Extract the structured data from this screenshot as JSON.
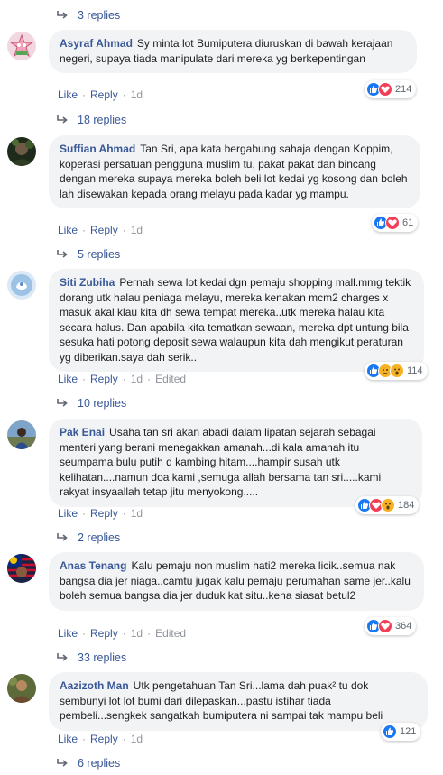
{
  "top_replies": {
    "label": "3 replies"
  },
  "comments": [
    {
      "author": "Asyraf Ahmad",
      "text": "Sy minta lot Bumiputera diuruskan di bawah kerajaan negeri, supaya tiada manipulate dari mereka yg berkepentingan",
      "like": "Like",
      "reply": "Reply",
      "time": "1d",
      "edited": "",
      "reaction_count": "214",
      "reactions": [
        "like-icon",
        "love-icon"
      ],
      "replies_label": "18 replies"
    },
    {
      "author": "Suffian Ahmad",
      "text": "Tan Sri, apa kata bergabung sahaja dengan Koppim, koperasi persatuan pengguna muslim tu, pakat pakat dan bincang dengan mereka supaya mereka boleh beli lot kedai yg kosong dan boleh lah disewakan kepada orang melayu pada kadar yg mampu.",
      "like": "Like",
      "reply": "Reply",
      "time": "1d",
      "edited": "",
      "reaction_count": "61",
      "reactions": [
        "like-icon",
        "love-icon"
      ],
      "replies_label": "5 replies"
    },
    {
      "author": "Siti Zubiha",
      "text": "Pernah sewa lot kedai dgn pemaju shopping mall.mmg tektik dorang utk halau peniaga melayu, mereka kenakan mcm2 charges x masuk akal klau kita dh sewa tempat mereka..utk mereka halau kita secara halus. Dan apabila kita tematkan sewaan, mereka dpt untung bila sesuka hati potong deposit sewa walaupun kita dah mengikut peraturan yg diberikan.saya dah serik..",
      "like": "Like",
      "reply": "Reply",
      "time": "1d",
      "edited": "Edited",
      "reaction_count": "114",
      "reactions": [
        "like-icon",
        "sad-icon",
        "wow-icon"
      ],
      "replies_label": "10 replies"
    },
    {
      "author": "Pak Enai",
      "text": "Usaha tan sri akan abadi dalam lipatan sejarah sebagai menteri yang berani menegakkan amanah...di kala amanah itu seumpama bulu putih d kambing hitam....hampir susah utk kelihatan....namun doa kami ,semuga allah bersama tan sri.....kami rakyat insyaallah tetap jitu menyokong.....",
      "like": "Like",
      "reply": "Reply",
      "time": "1d",
      "edited": "",
      "reaction_count": "184",
      "reactions": [
        "like-icon",
        "love-icon",
        "wow-icon"
      ],
      "replies_label": "2 replies"
    },
    {
      "author": "Anas Tenang",
      "text": "Kalu pemaju non muslim hati2 mereka licik..semua nak bangsa dia jer niaga..camtu jugak kalu pemaju perumahan same jer..kalu boleh semua bangsa dia jer duduk kat situ..kena siasat betul2",
      "like": "Like",
      "reply": "Reply",
      "time": "1d",
      "edited": "Edited",
      "reaction_count": "364",
      "reactions": [
        "like-icon",
        "love-icon"
      ],
      "replies_label": "33 replies"
    },
    {
      "author": "Aazizoth Man",
      "text": "Utk pengetahuan Tan Sri...lama dah puak² tu dok sembunyi lot lot bumi dari dilepaskan...pastu istihar tiada pembeli...sengkek sangatkah bumiputera ni sampai tak mampu beli",
      "like": "Like",
      "reply": "Reply",
      "time": "1d",
      "edited": "",
      "reaction_count": "121",
      "reactions": [
        "like-icon"
      ],
      "replies_label": "6 replies"
    }
  ],
  "colors": {
    "link": "#385898",
    "bubble": "#f2f3f5",
    "like": "#1877f2",
    "love": "#f33e58",
    "haha": "#f7b125"
  }
}
